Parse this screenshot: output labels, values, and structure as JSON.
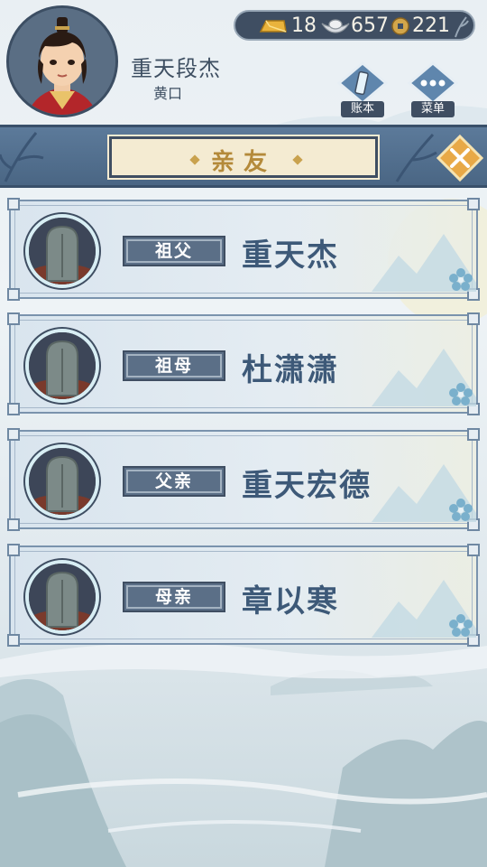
{
  "player": {
    "name": "重天段杰",
    "title": "黄口"
  },
  "currency": {
    "gold": "18",
    "silver": "657",
    "coins": "221"
  },
  "header_buttons": {
    "ledger_label": "账本",
    "menu_label": "菜单"
  },
  "page_title": "亲友",
  "relatives": [
    {
      "relation": "祖父",
      "name": "重天杰"
    },
    {
      "relation": "祖母",
      "name": "杜潇潇"
    },
    {
      "relation": "父亲",
      "name": "重天宏德"
    },
    {
      "relation": "母亲",
      "name": "章以寒"
    }
  ],
  "colors": {
    "accent": "#3f4e62",
    "banner": "#4a6684",
    "name_text": "#3d5978",
    "title_gold": "#b48a3a"
  }
}
